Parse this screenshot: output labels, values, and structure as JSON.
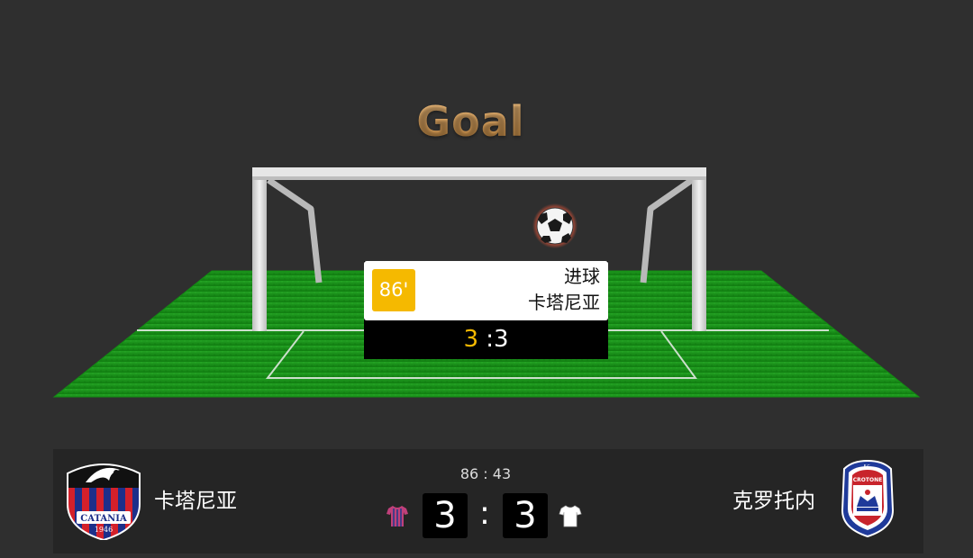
{
  "title": "Goal",
  "event": {
    "minute": "86'",
    "type": "进球",
    "team": "卡塔尼亚",
    "score_home": "3",
    "score_sep": " :",
    "score_away": "3"
  },
  "match": {
    "clock": "86 : 43",
    "home": {
      "name": "卡塔尼亚",
      "score": "3",
      "crest_text": "CATANIA",
      "crest_year": "1946",
      "jersey_color": "#c0407a"
    },
    "away": {
      "name": "克罗托内",
      "score": "3",
      "crest_text": "CROTONE",
      "crest_fc": "F.C.",
      "jersey_color": "#ffffff"
    },
    "separator": ":"
  },
  "colors": {
    "accent": "#f5b900",
    "pitch": "#1f8f1f",
    "background": "#2f2f2f"
  },
  "icons": [
    "soccer-ball-icon",
    "home-jersey-icon",
    "away-jersey-icon",
    "catania-crest-icon",
    "crotone-crest-icon"
  ]
}
